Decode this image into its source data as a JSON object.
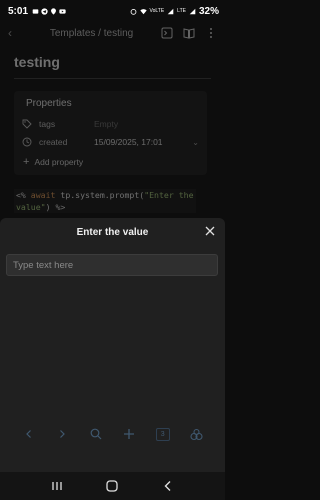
{
  "status": {
    "time": "5:01",
    "left_icons": [
      "dashcam-icon",
      "telegram-icon",
      "location-icon",
      "youtube-icon"
    ],
    "tiny_left": "VoLTE",
    "tiny_right": "LTE",
    "battery": "32%"
  },
  "topbar": {
    "breadcrumb": "Templates / testing",
    "icons": [
      "back-icon",
      "reading-view-icon",
      "book-icon",
      "more-icon"
    ]
  },
  "note": {
    "title": "testing"
  },
  "properties": {
    "header": "Properties",
    "rows": [
      {
        "icon": "tag-icon",
        "name": "tags",
        "value": "Empty"
      },
      {
        "icon": "clock-icon",
        "name": "created",
        "value": "15/09/2025, 17:01"
      }
    ],
    "add_label": "Add property"
  },
  "code": {
    "tag_open": "<%",
    "keyword": "await",
    "call": "tp.system.prompt(",
    "string_a": "\"Enter the",
    "string_b": "value\"",
    "paren": ")",
    "tag_close": "%>"
  },
  "modal": {
    "title": "Enter the value",
    "input_placeholder": "Type text here",
    "input_value": ""
  },
  "toolbar": {
    "tab_count": "3",
    "icons": [
      "back-arrow-icon",
      "forward-arrow-icon",
      "search-icon",
      "plus-icon",
      "tabs-icon",
      "menu-icon"
    ]
  },
  "navbar": {
    "icons": [
      "recents-icon",
      "home-icon",
      "back-icon"
    ]
  },
  "colors": {
    "background": "#0d0d0d",
    "modal": "#202020",
    "input": "#2f2f2f",
    "accent": "#5a86b0"
  }
}
